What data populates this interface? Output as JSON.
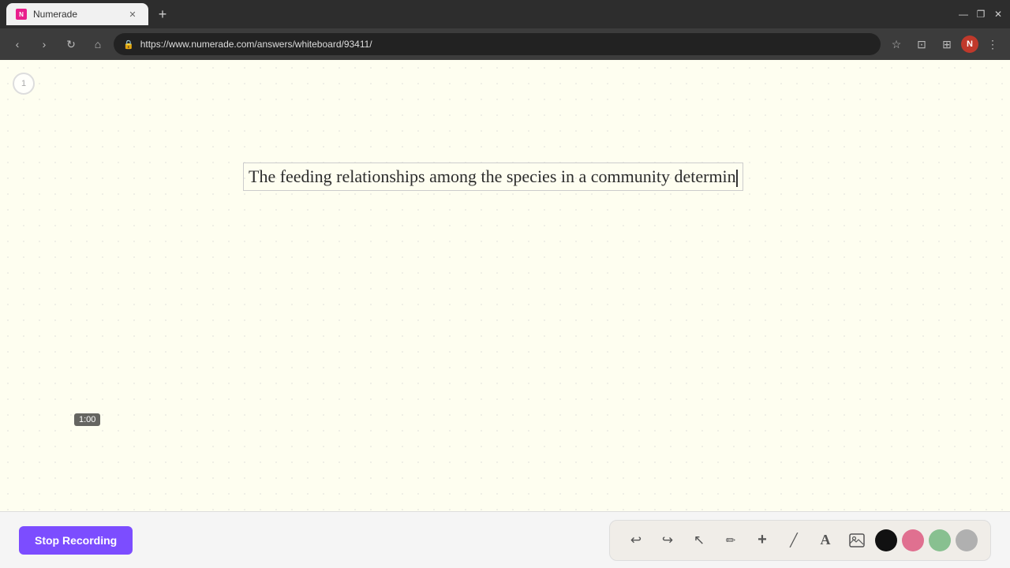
{
  "browser": {
    "tab_title": "Numerade",
    "url": "https://www.numerade.com/answers/whiteboard/93411/",
    "new_tab_label": "+",
    "window_controls": {
      "minimize": "—",
      "maximize": "❐",
      "close": "✕"
    }
  },
  "nav": {
    "back": "‹",
    "forward": "›",
    "reload": "↻",
    "home": "⌂",
    "lock": "🔒",
    "star": "☆",
    "extensions": "⊡",
    "profile_initial": "N",
    "more": "⋮"
  },
  "whiteboard": {
    "page_number": "1",
    "text_content": "The feeding relationships among the species in a community determin",
    "time": "1:00"
  },
  "toolbar": {
    "undo": "↩",
    "redo": "↪",
    "select": "↖",
    "pencil": "✏",
    "add": "+",
    "eraser": "/",
    "text": "A",
    "image": "🖼",
    "colors": {
      "black": "#111111",
      "pink": "#e07090",
      "green": "#88c090",
      "gray": "#b0b0b0"
    }
  },
  "recording": {
    "stop_label": "Stop Recording"
  }
}
